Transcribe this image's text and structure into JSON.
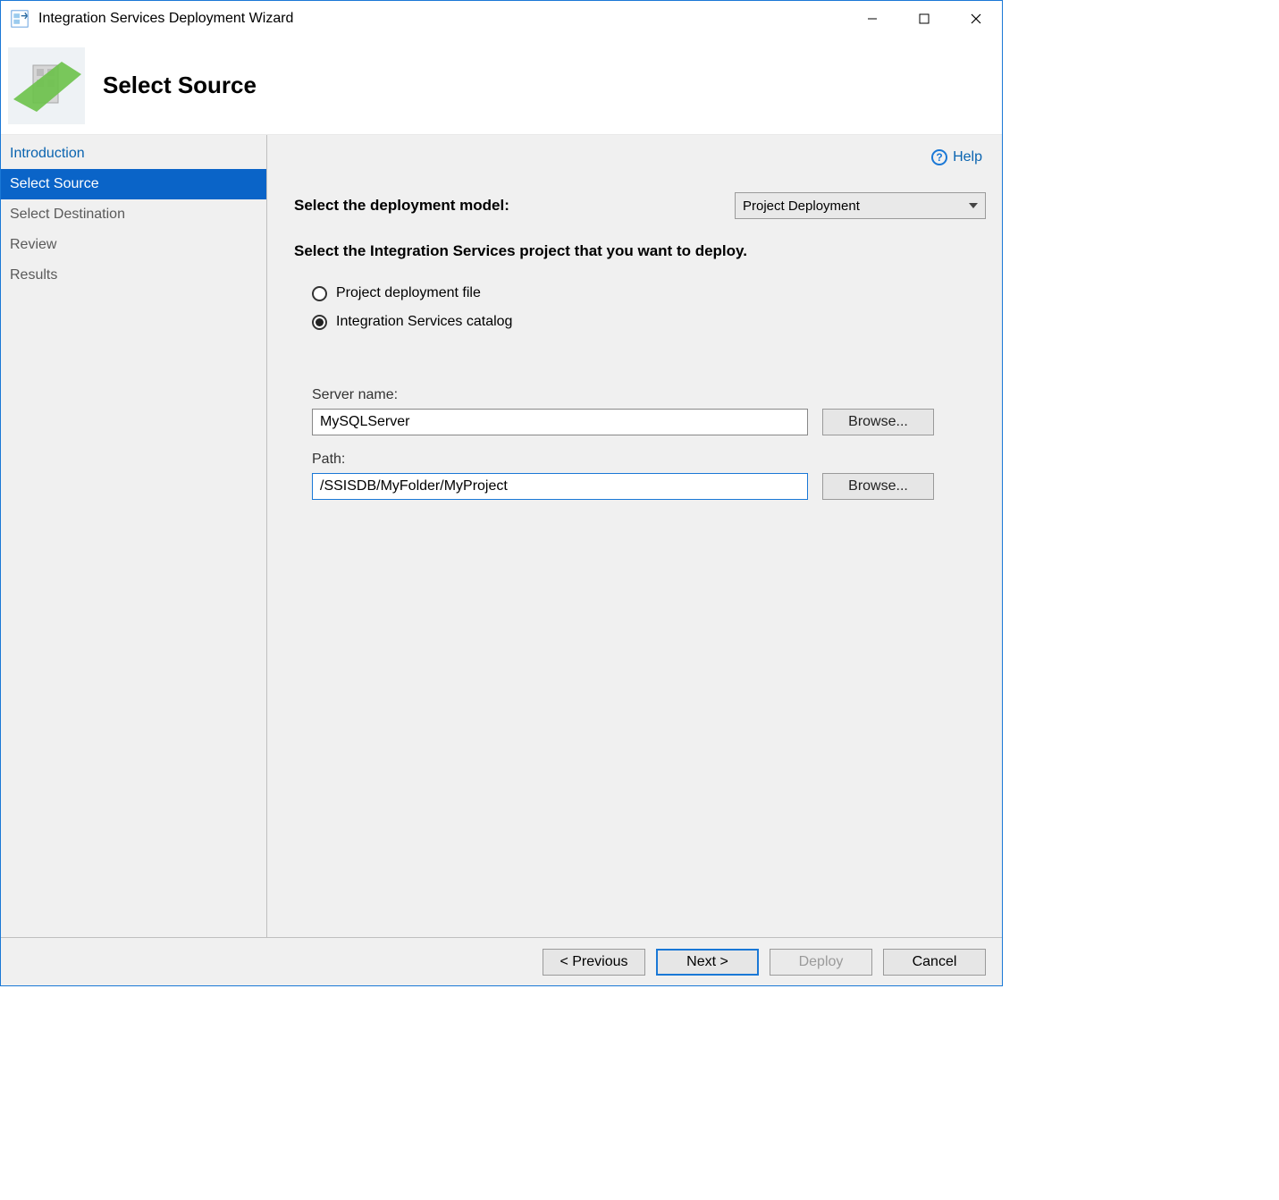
{
  "window": {
    "title": "Integration Services Deployment Wizard"
  },
  "banner": {
    "heading": "Select Source"
  },
  "sidebar": {
    "items": [
      {
        "label": "Introduction",
        "kind": "link"
      },
      {
        "label": "Select Source",
        "kind": "active"
      },
      {
        "label": "Select Destination",
        "kind": "normal"
      },
      {
        "label": "Review",
        "kind": "normal"
      },
      {
        "label": "Results",
        "kind": "normal"
      }
    ]
  },
  "help": {
    "label": "Help"
  },
  "content": {
    "model_label": "Select the deployment model:",
    "model_dropdown_value": "Project Deployment",
    "section_head": "Select the Integration Services project that you want to deploy.",
    "radio": {
      "option1": "Project deployment file",
      "option2": "Integration Services catalog",
      "selected": 2
    },
    "server": {
      "label": "Server name:",
      "value": "MySQLServer"
    },
    "path": {
      "label": "Path:",
      "value": "/SSISDB/MyFolder/MyProject"
    },
    "browse_label": "Browse..."
  },
  "footer": {
    "previous": "< Previous",
    "next": "Next >",
    "deploy": "Deploy",
    "cancel": "Cancel"
  }
}
